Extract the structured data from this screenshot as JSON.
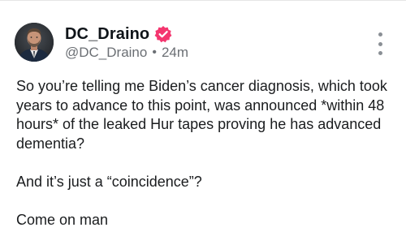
{
  "post": {
    "display_name": "DC_Draino",
    "handle": "@DC_Draino",
    "separator": "•",
    "time_ago": "24m",
    "paragraphs": [
      "So you’re telling me Biden’s cancer diagnosis, which took years to advance to this point, was announced *within 48 hours* of the leaked Hur tapes proving he has advanced dementia?",
      "And it’s just a “coincidence”?",
      "Come on man"
    ]
  },
  "icons": {
    "verified": "verified-badge-icon",
    "more": "more-options-icon"
  },
  "colors": {
    "verified_badge": "#f4366f",
    "secondary_text": "#6b6f74",
    "primary_text": "#0f1419"
  }
}
